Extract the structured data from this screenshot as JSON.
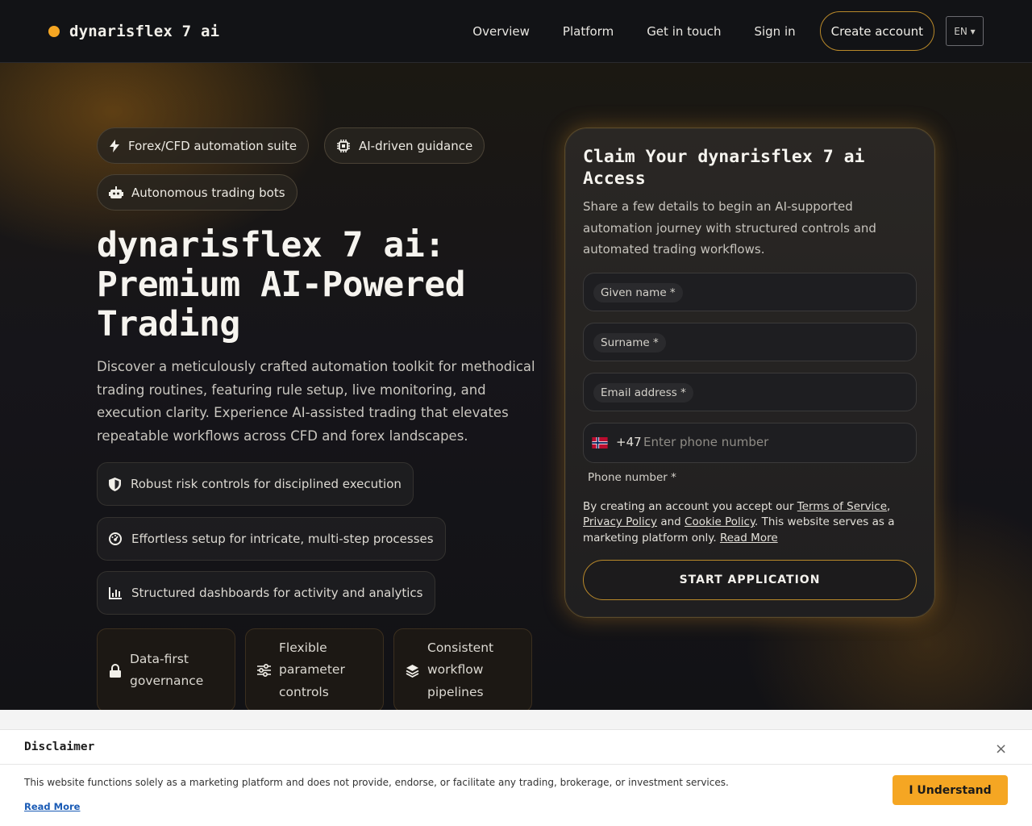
{
  "nav": {
    "brand": "dynarisflex 7 ai",
    "links": [
      "Overview",
      "Platform",
      "Get in touch",
      "Sign in"
    ],
    "create_account": "Create account",
    "language": "EN ▾"
  },
  "hero": {
    "tags": [
      "Forex/CFD automation suite",
      "AI-driven guidance",
      "Autonomous trading bots"
    ],
    "title": "dynarisflex 7 ai: Premium AI-Powered Trading",
    "description": "Discover a meticulously crafted automation toolkit for methodical trading routines, featuring rule setup, live monitoring, and execution clarity. Experience AI-assisted trading that elevates repeatable workflows across CFD and forex landscapes.",
    "features": [
      "Robust risk controls for disciplined execution",
      "Effortless setup for intricate, multi-step processes",
      "Structured dashboards for activity and analytics"
    ],
    "cards": [
      "Data-first governance",
      "Flexible parameter controls",
      "Consistent workflow pipelines"
    ]
  },
  "form": {
    "title": "Claim Your dynarisflex 7 ai Access",
    "subtitle": "Share a few details to begin an AI-supported automation journey with structured controls and automated trading workflows.",
    "given_name": "Given name *",
    "surname": "Surname *",
    "email": "Email address *",
    "phone_code": "+47",
    "phone_placeholder": "Enter phone number",
    "phone_label": "Phone number *",
    "legal_prefix": "By creating an account you accept our",
    "terms": "Terms of Service",
    "privacy": "Privacy Policy",
    "and": "and",
    "cookie": "Cookie Policy",
    "legal_suffix": ". This website serves as a marketing platform only.",
    "read_more": "Read More",
    "submit": "START APPLICATION"
  },
  "disclaimer": {
    "title": "Disclaimer",
    "close": "×",
    "text": "This website functions solely as a marketing platform and does not provide, endorse, or facilitate any trading, brokerage, or investment services.",
    "read_more": "Read More",
    "button": "I Understand"
  },
  "colors": {
    "accent": "#f5a623",
    "border_gold": "#b9892a",
    "background": "#121214"
  }
}
